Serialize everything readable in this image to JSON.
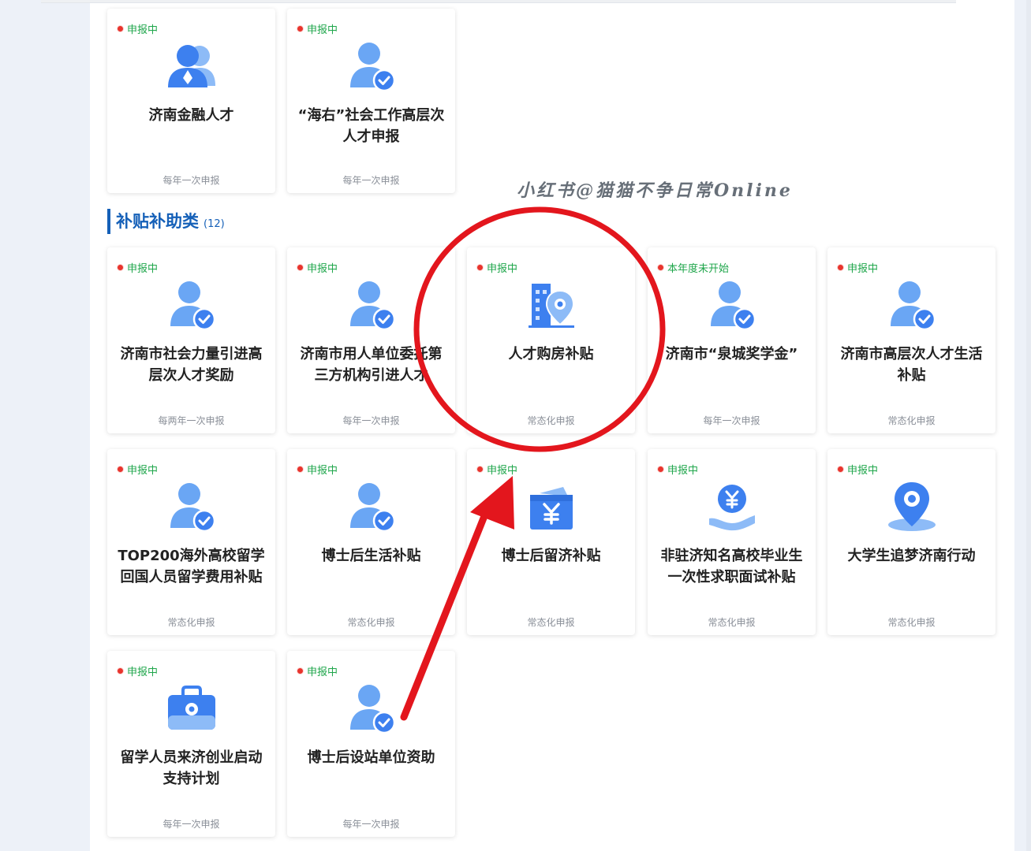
{
  "section": {
    "title": "补贴补助类",
    "count": "(12)"
  },
  "watermark": "小红书@猫猫不争日常Online",
  "cards": [
    {
      "status": "申报中",
      "title": "济南金融人才",
      "freq": "每年一次申报",
      "icon": "finance-talent-icon"
    },
    {
      "status": "申报中",
      "title": "“海右”社会工作高层次人才申报",
      "freq": "每年一次申报",
      "icon": "verified-person-icon"
    },
    {
      "status": "申报中",
      "title": "济南市社会力量引进高层次人才奖励",
      "freq": "每两年一次申报",
      "icon": "verified-person-icon"
    },
    {
      "status": "申报中",
      "title": "济南市用人单位委托第三方机构引进人才",
      "freq": "每年一次申报",
      "icon": "verified-person-icon"
    },
    {
      "status": "申报中",
      "title": "人才购房补贴",
      "freq": "常态化申报",
      "icon": "building-location-icon"
    },
    {
      "status": "本年度未开始",
      "title": "济南市“泉城奖学金”",
      "freq": "每年一次申报",
      "icon": "verified-person-icon"
    },
    {
      "status": "申报中",
      "title": "济南市高层次人才生活补贴",
      "freq": "常态化申报",
      "icon": "verified-person-icon"
    },
    {
      "status": "申报中",
      "title": "TOP200海外高校留学回国人员留学费用补贴",
      "freq": "常态化申报",
      "icon": "verified-person-icon"
    },
    {
      "status": "申报中",
      "title": "博士后生活补贴",
      "freq": "常态化申报",
      "icon": "verified-person-icon"
    },
    {
      "status": "申报中",
      "title": "博士后留济补贴",
      "freq": "常态化申报",
      "icon": "yuan-box-icon"
    },
    {
      "status": "申报中",
      "title": "非驻济知名高校毕业生一次性求职面试补贴",
      "freq": "常态化申报",
      "icon": "yuan-hand-icon"
    },
    {
      "status": "申报中",
      "title": "大学生追梦济南行动",
      "freq": "常态化申报",
      "icon": "location-pin-icon"
    },
    {
      "status": "申报中",
      "title": "留学人员来济创业启动支持计划",
      "freq": "每年一次申报",
      "icon": "briefcase-icon"
    },
    {
      "status": "申报中",
      "title": "博士后设站单位资助",
      "freq": "每年一次申报",
      "icon": "verified-person-icon"
    }
  ],
  "colors": {
    "accent": "#1560b8",
    "status_green": "#1fa64b",
    "annotation_red": "#e3161d"
  }
}
